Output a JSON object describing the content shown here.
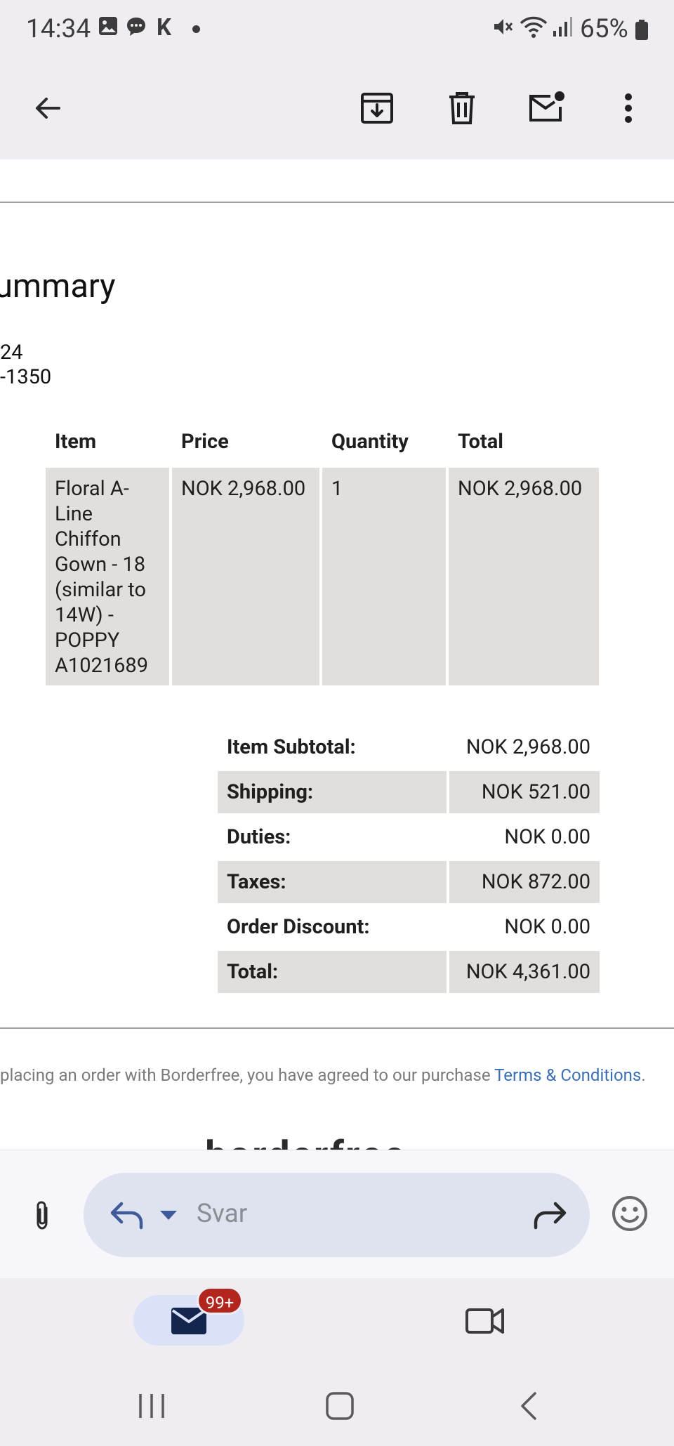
{
  "status_bar": {
    "time": "14:34",
    "k_icon": "K",
    "battery_text": "65%",
    "icons": [
      "gallery-icon",
      "chat-icon",
      "mute-icon",
      "wifi-icon",
      "signal-icon",
      "battery-icon"
    ]
  },
  "app_bar": {
    "icons": [
      "back-arrow-icon",
      "archive-icon",
      "delete-icon",
      "mark-unread-icon",
      "more-vert-icon"
    ]
  },
  "email": {
    "section_title": "ummary",
    "meta_line_1": "24",
    "meta_line_2": "-1350",
    "items_table": {
      "headers": [
        "Item",
        "Price",
        "Quantity",
        "Total"
      ],
      "rows": [
        {
          "item": "Floral A-Line Chiffon Gown - 18 (similar to 14W) - POPPY A1021689",
          "price": "NOK 2,968.00",
          "quantity": "1",
          "total": "NOK 2,968.00"
        }
      ]
    },
    "totals": [
      {
        "label": "Item Subtotal:",
        "value": "NOK 2,968.00"
      },
      {
        "label": "Shipping:",
        "value": "NOK 521.00"
      },
      {
        "label": "Duties:",
        "value": "NOK 0.00"
      },
      {
        "label": "Taxes:",
        "value": "NOK 872.00"
      },
      {
        "label": "Order Discount:",
        "value": "NOK 0.00"
      },
      {
        "label": "Total:",
        "value": "NOK 4,361.00"
      }
    ],
    "terms_text": "placing an order with Borderfree, you have agreed to our purchase ",
    "terms_link": "Terms & Conditions",
    "terms_end": ".",
    "brand_peek": "borderfree"
  },
  "reply_bar": {
    "placeholder": "Svar"
  },
  "bottom_nav": {
    "mail_badge": "99+"
  },
  "colors": {
    "bar_background": "#efedf2",
    "table_shade": "#e1dedb",
    "link": "#3b6fb4",
    "badge": "#b3261e",
    "reply_pill": "#dfe3ef",
    "mail_pill": "#d9e2f8"
  }
}
